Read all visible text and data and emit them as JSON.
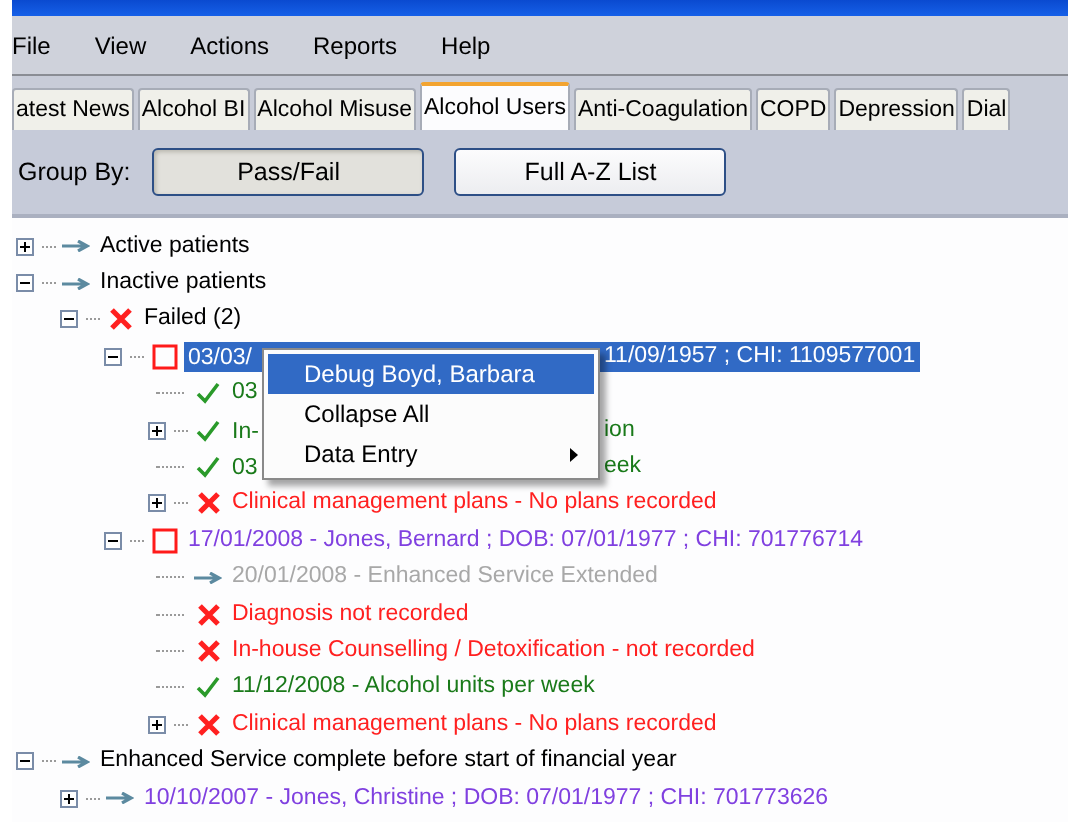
{
  "menu_bar": [
    "File",
    "View",
    "Actions",
    "Reports",
    "Help"
  ],
  "tabs": [
    {
      "label": "atest News",
      "selected": false
    },
    {
      "label": "Alcohol BI",
      "selected": false
    },
    {
      "label": "Alcohol Misuse",
      "selected": false
    },
    {
      "label": "Alcohol Users",
      "selected": true
    },
    {
      "label": "Anti-Coagulation",
      "selected": false
    },
    {
      "label": "COPD",
      "selected": false
    },
    {
      "label": "Depression",
      "selected": false
    },
    {
      "label": "Dial",
      "selected": false
    }
  ],
  "group_by": {
    "label": "Group By:",
    "buttons": [
      {
        "label": "Pass/Fail",
        "selected": true
      },
      {
        "label": "Full A-Z List",
        "selected": false
      }
    ]
  },
  "tree": [
    {
      "kind": "arrow",
      "label": "Active patients",
      "color": "#000000",
      "expanded": false
    },
    {
      "kind": "arrow",
      "label": "Inactive patients",
      "color": "#000000",
      "expanded": true,
      "children": [
        {
          "kind": "cross",
          "label": "Failed (2)",
          "color": "#000000",
          "expanded": true,
          "children": [
            {
              "kind": "square",
              "label": "03/03/",
              "label_after_menu": "11/09/1957 ; CHI: 1109577001",
              "selected": true,
              "expanded": true,
              "children": [
                {
                  "kind": "check",
                  "label": "03",
                  "color": "#1a7a1a"
                },
                {
                  "kind": "check",
                  "label": "In-",
                  "label_after_menu": "ion",
                  "color": "#1a7a1a",
                  "expanded": false
                },
                {
                  "kind": "check",
                  "label": "03",
                  "label_after_menu": "eek",
                  "color": "#1a7a1a"
                },
                {
                  "kind": "cross",
                  "label": "Clinical management plans - No plans recorded",
                  "color": "#ff2020",
                  "expanded": false
                }
              ]
            },
            {
              "kind": "square",
              "label": "17/01/2008 - Jones, Bernard ; DOB: 07/01/1977 ; CHI: 701776714",
              "color": "#8040e0",
              "selected": false,
              "expanded": true,
              "children": [
                {
                  "kind": "arrow",
                  "label": "20/01/2008 - Enhanced Service Extended",
                  "color": "#a8a8a8"
                },
                {
                  "kind": "cross",
                  "label": "Diagnosis not recorded",
                  "color": "#ff2020"
                },
                {
                  "kind": "cross",
                  "label": "In-house Counselling / Detoxification - not recorded",
                  "color": "#ff2020"
                },
                {
                  "kind": "check",
                  "label": "11/12/2008 - Alcohol units per week",
                  "color": "#1a7a1a"
                },
                {
                  "kind": "cross",
                  "label": "Clinical management plans - No plans recorded",
                  "color": "#ff2020",
                  "expanded": false
                }
              ]
            }
          ]
        }
      ]
    },
    {
      "kind": "arrow",
      "label": "Enhanced Service complete before start of financial year",
      "color": "#000000",
      "expanded": true,
      "children": [
        {
          "kind": "arrow",
          "label": "10/10/2007 - Jones, Christine ; DOB: 07/01/1977 ; CHI: 701773626",
          "color": "#8040e0",
          "expanded": false
        }
      ]
    }
  ],
  "context_menu": [
    {
      "label": "Debug Boyd, Barbara",
      "selected": true,
      "submenu": false
    },
    {
      "label": "Collapse All",
      "selected": false,
      "submenu": false
    },
    {
      "label": "Data Entry",
      "selected": false,
      "submenu": true
    }
  ]
}
